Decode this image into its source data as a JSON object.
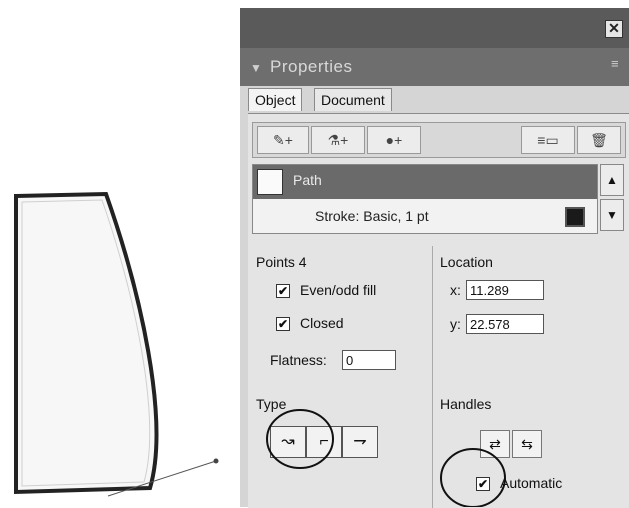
{
  "panel": {
    "title": "Properties",
    "close_label": "✕",
    "menu_icon": "panel-menu-icon"
  },
  "tabs": [
    {
      "label": "Object",
      "active": true
    },
    {
      "label": "Document",
      "active": false
    }
  ],
  "toolbar": {
    "icons": [
      "pen-icon",
      "fill-bucket-icon",
      "effects-icon",
      "layers-icon",
      "trash-icon"
    ],
    "glyphs": [
      "✎+",
      "⚗+",
      "●+",
      "≡▭",
      "🗑"
    ]
  },
  "objects": {
    "name": "Path",
    "stroke": "Stroke: Basic, 1 pt"
  },
  "points": {
    "label": "Points 4",
    "evenodd_label": "Even/odd fill",
    "evenodd_checked": true,
    "closed_label": "Closed",
    "closed_checked": true,
    "flatness_label": "Flatness:",
    "flatness_value": "0"
  },
  "location": {
    "label": "Location",
    "x_label": "x:",
    "x_value": "11.289",
    "y_label": "y:",
    "y_value": "22.578"
  },
  "type": {
    "label": "Type",
    "buttons": [
      "curve-point-icon",
      "corner-point-icon",
      "connector-point-icon"
    ],
    "glyphs": [
      "↝",
      "⌐",
      "⇁"
    ]
  },
  "handles": {
    "label": "Handles",
    "automatic_label": "Automatic",
    "automatic_checked": true,
    "glyphs": [
      "⇄",
      "⇆"
    ]
  },
  "checkmark": "✔",
  "scroll_up": "▲",
  "scroll_down": "▼"
}
